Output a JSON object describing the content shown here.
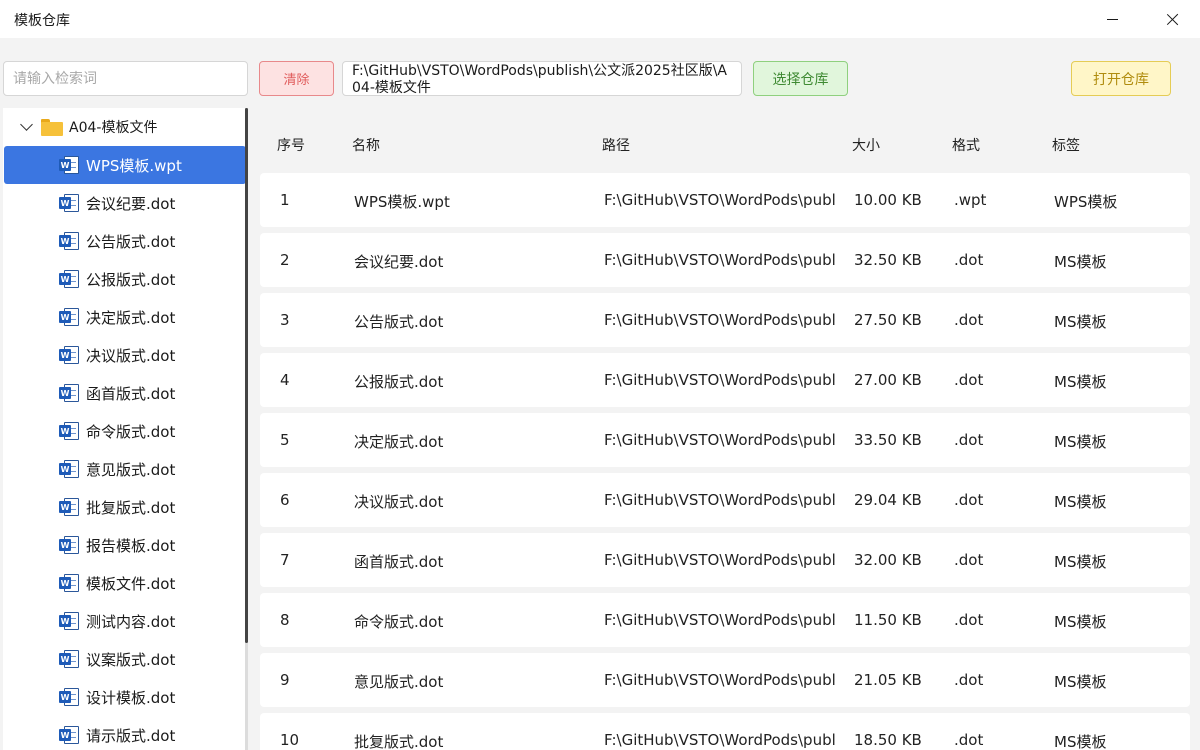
{
  "window": {
    "title": "模板仓库"
  },
  "toolbar": {
    "search_placeholder": "请输入检索词",
    "clear_label": "清除",
    "repo_path": "F:\\GitHub\\VSTO\\WordPods\\publish\\公文派2025社区版\\A04-模板文件",
    "select_label": "选择仓库",
    "open_label": "打开仓库"
  },
  "tree": {
    "folder": "A04-模板文件",
    "items": [
      "WPS模板.wpt",
      "会议纪要.dot",
      "公告版式.dot",
      "公报版式.dot",
      "决定版式.dot",
      "决议版式.dot",
      "函首版式.dot",
      "命令版式.dot",
      "意见版式.dot",
      "批复版式.dot",
      "报告模板.dot",
      "模板文件.dot",
      "测试内容.dot",
      "议案版式.dot",
      "设计模板.dot",
      "请示版式.dot"
    ],
    "selected_index": 0
  },
  "table": {
    "headers": {
      "idx": "序号",
      "name": "名称",
      "path": "路径",
      "size": "大小",
      "format": "格式",
      "tag": "标签"
    },
    "rows": [
      {
        "idx": "1",
        "name": "WPS模板.wpt",
        "path": "F:\\GitHub\\VSTO\\WordPods\\publ",
        "size": "10.00 KB",
        "format": ".wpt",
        "tag": "WPS模板"
      },
      {
        "idx": "2",
        "name": "会议纪要.dot",
        "path": "F:\\GitHub\\VSTO\\WordPods\\publ",
        "size": "32.50 KB",
        "format": ".dot",
        "tag": "MS模板"
      },
      {
        "idx": "3",
        "name": "公告版式.dot",
        "path": "F:\\GitHub\\VSTO\\WordPods\\publ",
        "size": "27.50 KB",
        "format": ".dot",
        "tag": "MS模板"
      },
      {
        "idx": "4",
        "name": "公报版式.dot",
        "path": "F:\\GitHub\\VSTO\\WordPods\\publ",
        "size": "27.00 KB",
        "format": ".dot",
        "tag": "MS模板"
      },
      {
        "idx": "5",
        "name": "决定版式.dot",
        "path": "F:\\GitHub\\VSTO\\WordPods\\publ",
        "size": "33.50 KB",
        "format": ".dot",
        "tag": "MS模板"
      },
      {
        "idx": "6",
        "name": "决议版式.dot",
        "path": "F:\\GitHub\\VSTO\\WordPods\\publ",
        "size": "29.04 KB",
        "format": ".dot",
        "tag": "MS模板"
      },
      {
        "idx": "7",
        "name": "函首版式.dot",
        "path": "F:\\GitHub\\VSTO\\WordPods\\publ",
        "size": "32.00 KB",
        "format": ".dot",
        "tag": "MS模板"
      },
      {
        "idx": "8",
        "name": "命令版式.dot",
        "path": "F:\\GitHub\\VSTO\\WordPods\\publ",
        "size": "11.50 KB",
        "format": ".dot",
        "tag": "MS模板"
      },
      {
        "idx": "9",
        "name": "意见版式.dot",
        "path": "F:\\GitHub\\VSTO\\WordPods\\publ",
        "size": "21.05 KB",
        "format": ".dot",
        "tag": "MS模板"
      },
      {
        "idx": "10",
        "name": "批复版式.dot",
        "path": "F:\\GitHub\\VSTO\\WordPods\\publ",
        "size": "18.50 KB",
        "format": ".dot",
        "tag": "MS模板"
      }
    ]
  },
  "icons": {
    "folder": "folder-icon",
    "file": "word-doc-icon",
    "expand": "chevron-down-icon"
  },
  "colors": {
    "selection": "#3b76e1",
    "clear_button": "#fde2e2",
    "select_button": "#e1f6dc",
    "open_button": "#fff6c8"
  }
}
